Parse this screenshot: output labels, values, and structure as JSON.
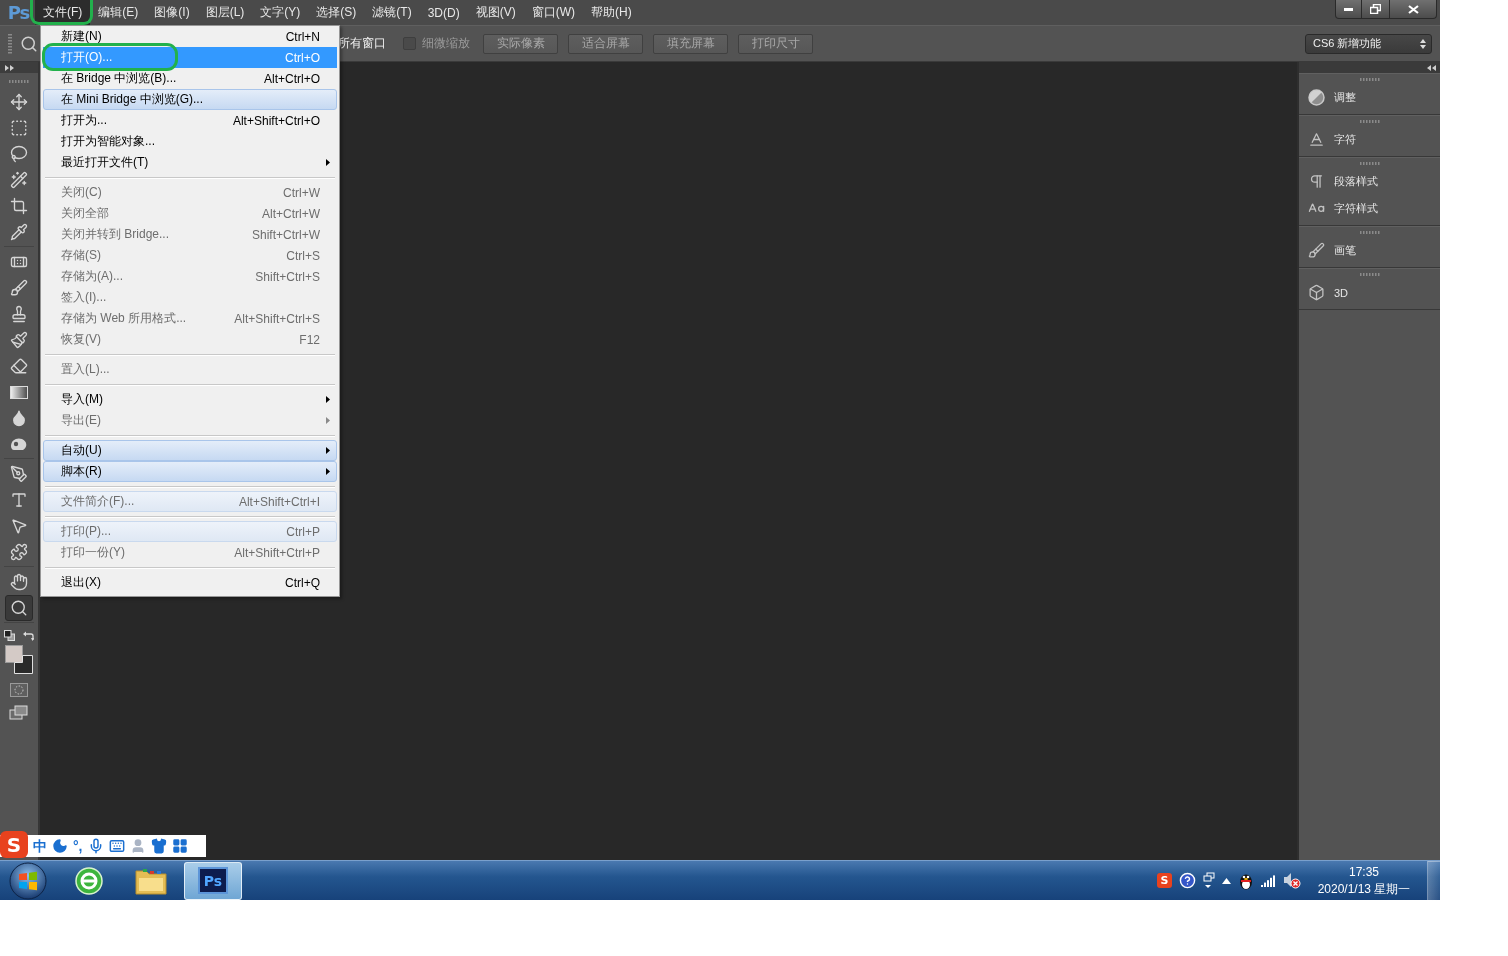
{
  "app": {
    "logo": "Ps"
  },
  "menu_bar": {
    "items": [
      {
        "label": "文件(F)",
        "selected": true,
        "highlighted": true
      },
      {
        "label": "编辑(E)",
        "selected": false,
        "highlighted": false
      },
      {
        "label": "图像(I)",
        "selected": false,
        "highlighted": false
      },
      {
        "label": "图层(L)",
        "selected": false,
        "highlighted": false
      },
      {
        "label": "文字(Y)",
        "selected": false,
        "highlighted": false
      },
      {
        "label": "选择(S)",
        "selected": false,
        "highlighted": false
      },
      {
        "label": "滤镜(T)",
        "selected": false,
        "highlighted": false
      },
      {
        "label": "3D(D)",
        "selected": false,
        "highlighted": false
      },
      {
        "label": "视图(V)",
        "selected": false,
        "highlighted": false
      },
      {
        "label": "窗口(W)",
        "selected": false,
        "highlighted": false
      },
      {
        "label": "帮助(H)",
        "selected": false,
        "highlighted": false
      }
    ]
  },
  "options_bar": {
    "label": "所有窗口",
    "checkbox": {
      "label": "细微缩放",
      "checked": false,
      "disabled": true
    },
    "buttons": [
      {
        "label": "实际像素",
        "disabled": true
      },
      {
        "label": "适合屏幕",
        "disabled": true
      },
      {
        "label": "填充屏幕",
        "disabled": true
      },
      {
        "label": "打印尺寸",
        "disabled": true
      }
    ],
    "workspace": "CS6 新增功能"
  },
  "file_menu": {
    "items": [
      {
        "kind": "item",
        "label": "新建(N)",
        "shortcut": "Ctrl+N",
        "submenu": false,
        "disabled": false,
        "selected": false,
        "hover": false,
        "highlighted": false
      },
      {
        "kind": "item",
        "label": "打开(O)...",
        "shortcut": "Ctrl+O",
        "submenu": false,
        "disabled": false,
        "selected": true,
        "hover": false,
        "highlighted": true
      },
      {
        "kind": "item",
        "label": "在 Bridge 中浏览(B)...",
        "shortcut": "Alt+Ctrl+O",
        "submenu": false,
        "disabled": false,
        "selected": false,
        "hover": false,
        "highlighted": false
      },
      {
        "kind": "item",
        "label": "在 Mini Bridge 中浏览(G)...",
        "submenu": false,
        "disabled": false,
        "selected": false,
        "hover": true,
        "highlighted": false
      },
      {
        "kind": "item",
        "label": "打开为...",
        "shortcut": "Alt+Shift+Ctrl+O",
        "submenu": false,
        "disabled": false,
        "selected": false,
        "hover": false,
        "highlighted": false
      },
      {
        "kind": "item",
        "label": "打开为智能对象...",
        "submenu": false,
        "disabled": false,
        "selected": false,
        "hover": false,
        "highlighted": false
      },
      {
        "kind": "item",
        "label": "最近打开文件(T)",
        "submenu": true,
        "disabled": false,
        "selected": false,
        "hover": false,
        "highlighted": false
      },
      {
        "kind": "separator"
      },
      {
        "kind": "item",
        "label": "关闭(C)",
        "shortcut": "Ctrl+W",
        "submenu": false,
        "disabled": true,
        "selected": false,
        "hover": false,
        "highlighted": false
      },
      {
        "kind": "item",
        "label": "关闭全部",
        "shortcut": "Alt+Ctrl+W",
        "submenu": false,
        "disabled": true,
        "selected": false,
        "hover": false,
        "highlighted": false
      },
      {
        "kind": "item",
        "label": "关闭并转到 Bridge...",
        "shortcut": "Shift+Ctrl+W",
        "submenu": false,
        "disabled": true,
        "selected": false,
        "hover": false,
        "highlighted": false
      },
      {
        "kind": "item",
        "label": "存储(S)",
        "shortcut": "Ctrl+S",
        "submenu": false,
        "disabled": true,
        "selected": false,
        "hover": false,
        "highlighted": false
      },
      {
        "kind": "item",
        "label": "存储为(A)...",
        "shortcut": "Shift+Ctrl+S",
        "submenu": false,
        "disabled": true,
        "selected": false,
        "hover": false,
        "highlighted": false
      },
      {
        "kind": "item",
        "label": "签入(I)...",
        "submenu": false,
        "disabled": true,
        "selected": false,
        "hover": false,
        "highlighted": false
      },
      {
        "kind": "item",
        "label": "存储为 Web 所用格式...",
        "shortcut": "Alt+Shift+Ctrl+S",
        "submenu": false,
        "disabled": true,
        "selected": false,
        "hover": false,
        "highlighted": false
      },
      {
        "kind": "item",
        "label": "恢复(V)",
        "shortcut": "F12",
        "submenu": false,
        "disabled": true,
        "selected": false,
        "hover": false,
        "highlighted": false
      },
      {
        "kind": "separator"
      },
      {
        "kind": "item",
        "label": "置入(L)...",
        "submenu": false,
        "disabled": true,
        "selected": false,
        "hover": false,
        "highlighted": false
      },
      {
        "kind": "separator"
      },
      {
        "kind": "item",
        "label": "导入(M)",
        "submenu": true,
        "disabled": false,
        "selected": false,
        "hover": false,
        "highlighted": false
      },
      {
        "kind": "item",
        "label": "导出(E)",
        "submenu": true,
        "disabled": true,
        "selected": false,
        "hover": false,
        "highlighted": false
      },
      {
        "kind": "separator"
      },
      {
        "kind": "item",
        "label": "自动(U)",
        "submenu": true,
        "disabled": false,
        "selected": false,
        "hover": true,
        "highlighted": false
      },
      {
        "kind": "item",
        "label": "脚本(R)",
        "submenu": true,
        "disabled": false,
        "selected": false,
        "hover": true,
        "highlighted": false
      },
      {
        "kind": "separator"
      },
      {
        "kind": "item",
        "label": "文件简介(F)...",
        "shortcut": "Alt+Shift+Ctrl+I",
        "submenu": false,
        "disabled": true,
        "selected": false,
        "hover": true,
        "highlighted": false
      },
      {
        "kind": "separator"
      },
      {
        "kind": "item",
        "label": "打印(P)...",
        "shortcut": "Ctrl+P",
        "submenu": false,
        "disabled": true,
        "selected": false,
        "hover": true,
        "highlighted": false
      },
      {
        "kind": "item",
        "label": "打印一份(Y)",
        "shortcut": "Alt+Shift+Ctrl+P",
        "submenu": false,
        "disabled": true,
        "selected": false,
        "hover": false,
        "highlighted": false
      },
      {
        "kind": "separator"
      },
      {
        "kind": "item",
        "label": "退出(X)",
        "shortcut": "Ctrl+Q",
        "submenu": false,
        "disabled": false,
        "selected": false,
        "hover": false,
        "highlighted": false
      }
    ]
  },
  "toolbox": {
    "groups": [
      {
        "tools": [
          {
            "kind": "move",
            "selected": false
          },
          {
            "kind": "marquee",
            "selected": false
          },
          {
            "kind": "lasso",
            "selected": false
          },
          {
            "kind": "wand",
            "selected": false
          },
          {
            "kind": "crop",
            "selected": false
          },
          {
            "kind": "eyedropper",
            "selected": false
          }
        ]
      },
      {
        "tools": [
          {
            "kind": "healing",
            "selected": false
          },
          {
            "kind": "brush",
            "selected": false
          },
          {
            "kind": "stamp",
            "selected": false
          },
          {
            "kind": "history_brush",
            "selected": false
          },
          {
            "kind": "eraser",
            "selected": false
          },
          {
            "kind": "gradient",
            "selected": false
          },
          {
            "kind": "blur",
            "selected": false
          },
          {
            "kind": "sponge",
            "selected": false
          }
        ]
      },
      {
        "tools": [
          {
            "kind": "pen",
            "selected": false
          },
          {
            "kind": "type",
            "selected": false
          },
          {
            "kind": "path_select",
            "selected": false
          },
          {
            "kind": "shape",
            "selected": false
          }
        ]
      },
      {
        "tools": [
          {
            "kind": "hand",
            "selected": false
          },
          {
            "kind": "zoom",
            "selected": true
          }
        ]
      }
    ],
    "swatches": [
      {
        "color": "#d4cac6"
      },
      {
        "color": "#2a2a2a"
      }
    ]
  },
  "panel_dock": {
    "groups": [
      {
        "items": [
          {
            "kind": "adjustments",
            "label": "调整"
          }
        ]
      },
      {
        "items": [
          {
            "kind": "character",
            "label": "字符"
          }
        ]
      },
      {
        "items": [
          {
            "kind": "paragraph_styles",
            "label": "段落样式"
          },
          {
            "kind": "character_styles",
            "label": "字符样式"
          }
        ]
      },
      {
        "items": [
          {
            "kind": "brush",
            "label": "画笔"
          }
        ]
      },
      {
        "items": [
          {
            "kind": "model",
            "label": "3D"
          }
        ]
      }
    ]
  },
  "ime_bar": {
    "logo": "S",
    "mode": "中",
    "punctuation": "°,"
  },
  "taskbar": {
    "apps": [
      {
        "kind": "browser",
        "active": false
      },
      {
        "kind": "folder",
        "active": false
      },
      {
        "kind": "photoshop",
        "badge": "Ps",
        "active": true
      }
    ],
    "tray": {
      "ime_logo": "S",
      "time": "17:35",
      "date": "2020/1/13 星期一"
    }
  }
}
